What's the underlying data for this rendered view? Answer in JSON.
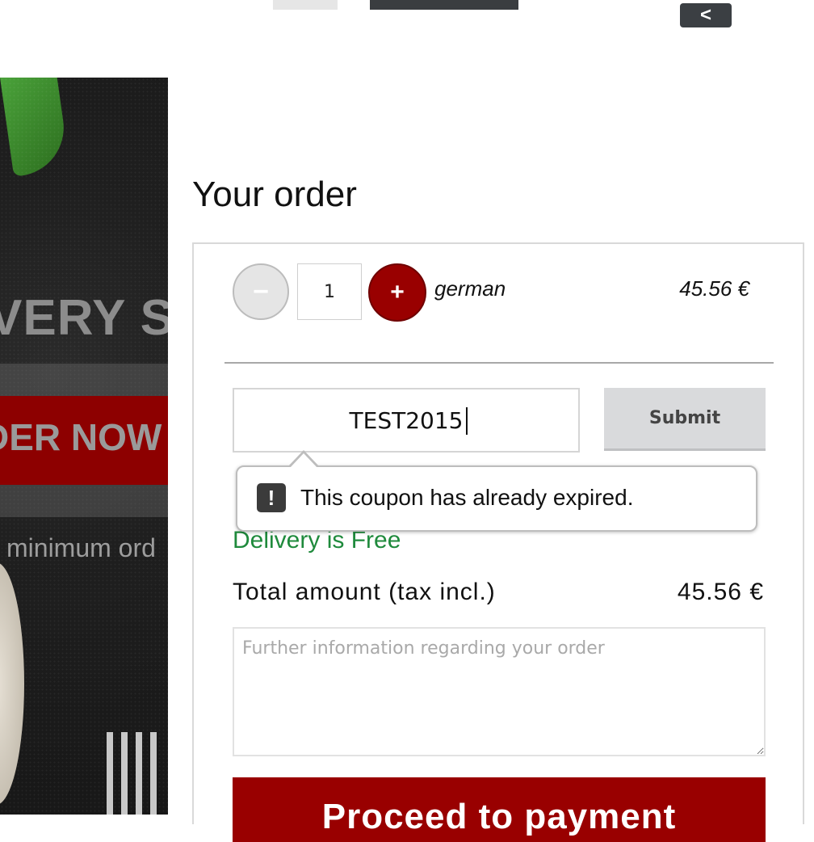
{
  "topbar": {
    "back_label": "<"
  },
  "hero": {
    "headline": "VERY S",
    "order_button": "DER NOW",
    "minimum_text": "minimum ord"
  },
  "order": {
    "title": "Your order",
    "item": {
      "quantity": "1",
      "minus_label": "−",
      "plus_label": "+",
      "name": "german",
      "price": "45.56 €"
    },
    "coupon": {
      "value": "TEST2015",
      "submit_label": "Submit"
    },
    "tooltip": {
      "icon": "exclamation-icon",
      "text": "This coupon has already expired."
    },
    "delivery_text": "Delivery is Free",
    "total_label": "Total amount (tax incl.)",
    "total_value": "45.56 €",
    "notes_placeholder": "Further information regarding your order",
    "proceed_label": "Proceed to payment"
  },
  "colors": {
    "accent": "#990000",
    "success": "#1f8a3c"
  }
}
